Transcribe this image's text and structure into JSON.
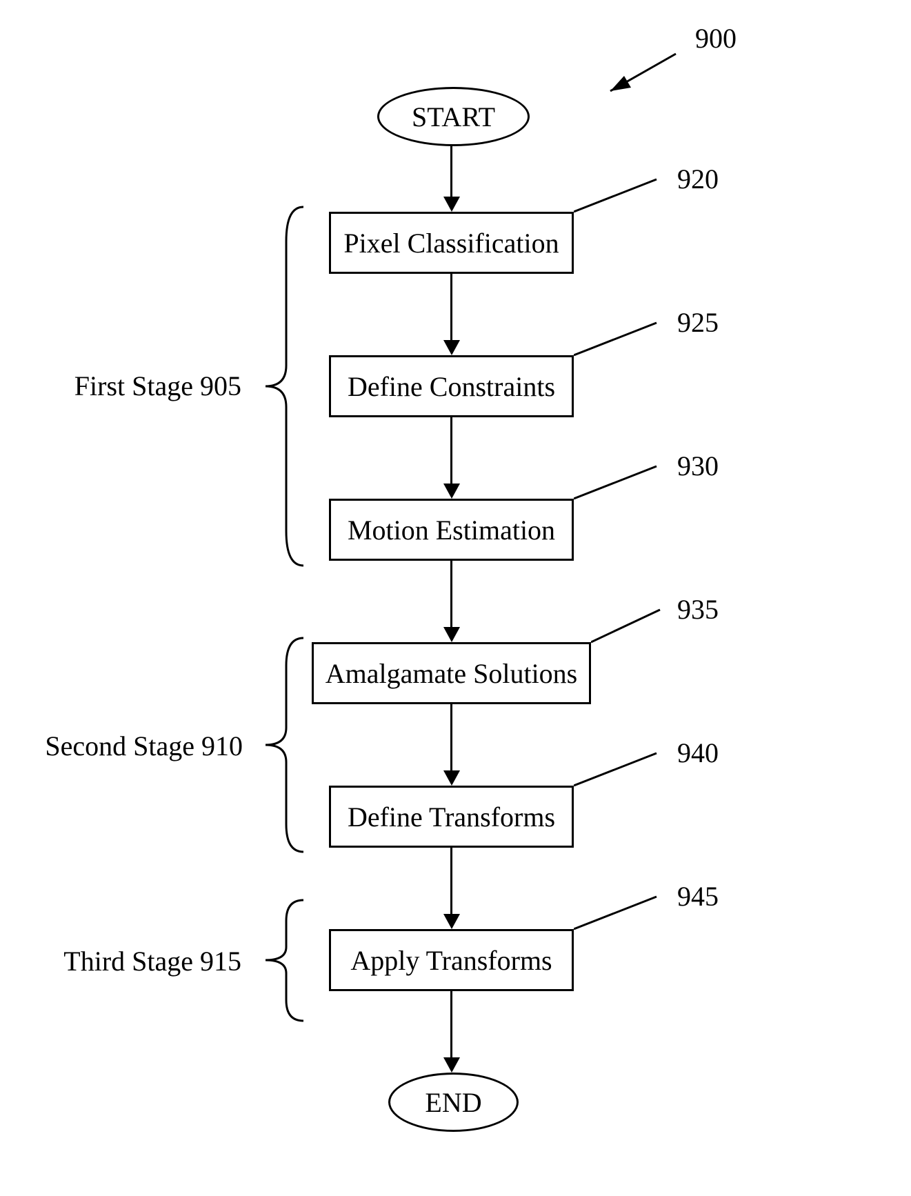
{
  "diagram": {
    "id": "900",
    "terminals": {
      "start": "START",
      "end": "END"
    },
    "boxes": {
      "b920": {
        "label": "Pixel Classification",
        "ref": "920"
      },
      "b925": {
        "label": "Define Constraints",
        "ref": "925"
      },
      "b930": {
        "label": "Motion Estimation",
        "ref": "930"
      },
      "b935": {
        "label": "Amalgamate Solutions",
        "ref": "935"
      },
      "b940": {
        "label": "Define Transforms",
        "ref": "940"
      },
      "b945": {
        "label": "Apply Transforms",
        "ref": "945"
      }
    },
    "stages": {
      "s1": "First Stage 905",
      "s2": "Second Stage 910",
      "s3": "Third Stage 915"
    }
  }
}
